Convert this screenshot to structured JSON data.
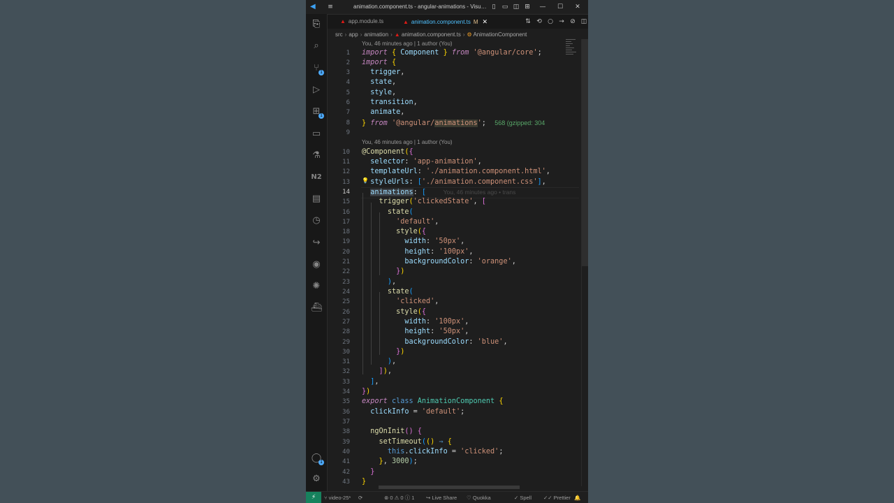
{
  "window": {
    "title": "animation.component.ts - angular-animations - Visu…",
    "colors": {
      "accent": "#0078d4",
      "remote": "#16825d",
      "tab_active": "#4fc1ff"
    }
  },
  "titlebar": {
    "menu_icon": "≡",
    "layout_icons": [
      "▯",
      "▭",
      "◫",
      "⊞"
    ],
    "controls": [
      "—",
      "☐",
      "✕"
    ]
  },
  "activity_bar": {
    "items": [
      {
        "name": "explorer-icon",
        "glyph": "⎘"
      },
      {
        "name": "search-icon",
        "glyph": "⌕"
      },
      {
        "name": "source-control-icon",
        "glyph": "⑂",
        "badge": "1"
      },
      {
        "name": "run-debug-icon",
        "glyph": "▷"
      },
      {
        "name": "extensions-icon",
        "glyph": "⊞",
        "badge": "1"
      },
      {
        "name": "remote-explorer-icon",
        "glyph": "▭"
      },
      {
        "name": "testing-icon",
        "glyph": "⚗"
      },
      {
        "name": "nx-console-icon",
        "glyph": "N2"
      },
      {
        "name": "clipboard-icon",
        "glyph": "▤"
      },
      {
        "name": "timeline-icon",
        "glyph": "◷"
      },
      {
        "name": "live-share-icon",
        "glyph": "↪"
      },
      {
        "name": "github-icon",
        "glyph": "◉"
      },
      {
        "name": "gitlens-icon",
        "glyph": "✺"
      },
      {
        "name": "docker-icon",
        "glyph": "⛴"
      }
    ],
    "bottom": [
      {
        "name": "accounts-icon",
        "glyph": "◯",
        "badge": "1"
      },
      {
        "name": "settings-gear-icon",
        "glyph": "⚙"
      }
    ]
  },
  "tabs": [
    {
      "label": "app.module.ts",
      "active": false
    },
    {
      "label": "animation.component.ts",
      "active": true,
      "modified": "M"
    }
  ],
  "tab_actions": [
    "⇅",
    "⟲",
    "○",
    "→",
    "⊘",
    "◫",
    "⋯"
  ],
  "breadcrumb": [
    "src",
    "app",
    "animation",
    "animation.component.ts",
    "AnimationComponent"
  ],
  "codelens": [
    "You, 46 minutes ago | 1 author (You)",
    "You, 46 minutes ago | 1 author (You)"
  ],
  "inline_hints": {
    "import_size": "568 (gzipped: 304",
    "blame": "You, 46 minutes ago • trans"
  },
  "editor": {
    "current_line": 14,
    "line_numbers": [
      "1",
      "2",
      "3",
      "4",
      "5",
      "6",
      "7",
      "8",
      "9",
      "10",
      "11",
      "12",
      "13",
      "14",
      "15",
      "16",
      "17",
      "18",
      "19",
      "20",
      "21",
      "22",
      "23",
      "24",
      "25",
      "26",
      "27",
      "28",
      "29",
      "30",
      "31",
      "32",
      "33",
      "34",
      "35",
      "36",
      "37",
      "38",
      "39",
      "40",
      "41",
      "42",
      "43"
    ]
  },
  "statusbar": {
    "remote": "⚡",
    "branch": "video-25*",
    "sync": "⟳",
    "problems": "⊗ 0 ⚠ 0 ⓘ 1",
    "live_share": "Live Share",
    "quokka": "Quokka",
    "spell": "Spell",
    "prettier": "Prettier",
    "bell": "🔔"
  }
}
